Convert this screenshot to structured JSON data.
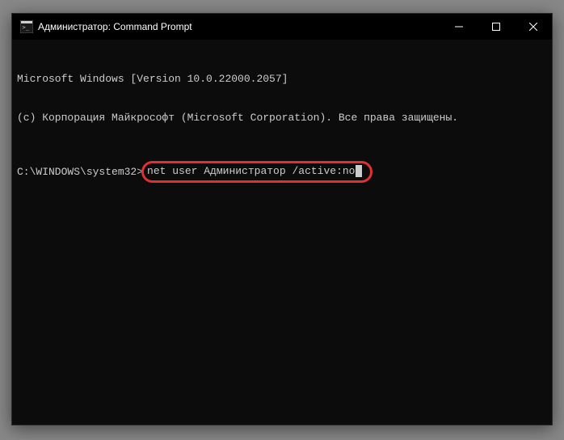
{
  "window": {
    "title": "Администратор: Command Prompt"
  },
  "terminal": {
    "line1": "Microsoft Windows [Version 10.0.22000.2057]",
    "line2": "(c) Корпорация Майкрософт (Microsoft Corporation). Все права защищены.",
    "prompt": "C:\\WINDOWS\\system32>",
    "command": "net user Администратор /active:no"
  },
  "icons": {
    "app": "cmd-icon",
    "minimize": "minimize-icon",
    "maximize": "maximize-icon",
    "close": "close-icon"
  }
}
